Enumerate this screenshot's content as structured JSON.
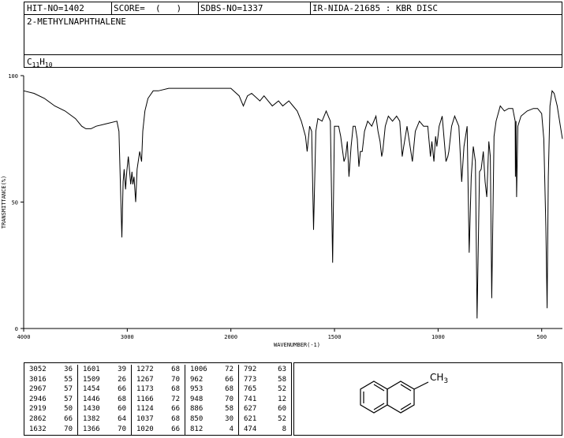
{
  "header": {
    "hit_no": "HIT-NO=1402",
    "score": "SCORE=  (   )",
    "sdbs_no": "SDBS-NO=1337",
    "ir_nida": "IR-NIDA-21685 : KBR DISC",
    "compound_name": "2-METHYLNAPHTHALENE",
    "formula_c": "C",
    "formula_c_count": "11",
    "formula_h": "H",
    "formula_h_count": "10"
  },
  "chart_data": {
    "type": "line",
    "title": "",
    "xlabel": "WAVENUMBER(-1)",
    "ylabel": "TRANSMITTANCE(%)",
    "xlim": [
      4000,
      400
    ],
    "ylim": [
      0,
      100
    ],
    "x_reversed": true,
    "x_ticks": [
      4000,
      3000,
      2000,
      1500,
      1000,
      500
    ],
    "y_ticks": [
      0,
      50,
      100
    ],
    "x_tick_labels": [
      "4000",
      "3000",
      "2000",
      "1500",
      "1000",
      "500"
    ],
    "y_tick_labels": [
      "0",
      "50",
      "100"
    ],
    "grid": false,
    "series": [
      {
        "points": [
          [
            4000,
            94
          ],
          [
            3900,
            93
          ],
          [
            3800,
            91
          ],
          [
            3700,
            88
          ],
          [
            3600,
            86
          ],
          [
            3500,
            83
          ],
          [
            3440,
            80
          ],
          [
            3400,
            79
          ],
          [
            3350,
            79
          ],
          [
            3300,
            80
          ],
          [
            3200,
            81
          ],
          [
            3100,
            82
          ],
          [
            3080,
            78
          ],
          [
            3052,
            36
          ],
          [
            3040,
            58
          ],
          [
            3030,
            63
          ],
          [
            3016,
            55
          ],
          [
            3005,
            62
          ],
          [
            2990,
            68
          ],
          [
            2967,
            57
          ],
          [
            2955,
            62
          ],
          [
            2946,
            57
          ],
          [
            2935,
            60
          ],
          [
            2919,
            50
          ],
          [
            2905,
            63
          ],
          [
            2880,
            70
          ],
          [
            2862,
            66
          ],
          [
            2850,
            78
          ],
          [
            2830,
            86
          ],
          [
            2800,
            91
          ],
          [
            2750,
            94
          ],
          [
            2700,
            94
          ],
          [
            2600,
            95
          ],
          [
            2500,
            95
          ],
          [
            2400,
            95
          ],
          [
            2300,
            95
          ],
          [
            2200,
            95
          ],
          [
            2100,
            95
          ],
          [
            2000,
            95
          ],
          [
            1960,
            92
          ],
          [
            1940,
            88
          ],
          [
            1920,
            92
          ],
          [
            1900,
            93
          ],
          [
            1860,
            90
          ],
          [
            1840,
            92
          ],
          [
            1800,
            88
          ],
          [
            1770,
            90
          ],
          [
            1750,
            88
          ],
          [
            1720,
            90
          ],
          [
            1700,
            88
          ],
          [
            1680,
            86
          ],
          [
            1660,
            82
          ],
          [
            1640,
            76
          ],
          [
            1632,
            70
          ],
          [
            1620,
            80
          ],
          [
            1610,
            78
          ],
          [
            1601,
            39
          ],
          [
            1590,
            78
          ],
          [
            1580,
            83
          ],
          [
            1560,
            82
          ],
          [
            1540,
            86
          ],
          [
            1520,
            82
          ],
          [
            1509,
            26
          ],
          [
            1500,
            80
          ],
          [
            1480,
            80
          ],
          [
            1470,
            76
          ],
          [
            1454,
            66
          ],
          [
            1446,
            68
          ],
          [
            1438,
            74
          ],
          [
            1430,
            60
          ],
          [
            1420,
            72
          ],
          [
            1410,
            80
          ],
          [
            1400,
            80
          ],
          [
            1390,
            75
          ],
          [
            1382,
            64
          ],
          [
            1375,
            70
          ],
          [
            1366,
            70
          ],
          [
            1355,
            78
          ],
          [
            1340,
            82
          ],
          [
            1320,
            80
          ],
          [
            1300,
            84
          ],
          [
            1290,
            78
          ],
          [
            1280,
            74
          ],
          [
            1272,
            68
          ],
          [
            1267,
            70
          ],
          [
            1255,
            80
          ],
          [
            1240,
            84
          ],
          [
            1220,
            82
          ],
          [
            1200,
            84
          ],
          [
            1185,
            82
          ],
          [
            1173,
            68
          ],
          [
            1166,
            72
          ],
          [
            1150,
            80
          ],
          [
            1124,
            66
          ],
          [
            1110,
            78
          ],
          [
            1090,
            82
          ],
          [
            1070,
            80
          ],
          [
            1050,
            80
          ],
          [
            1037,
            68
          ],
          [
            1030,
            74
          ],
          [
            1020,
            66
          ],
          [
            1012,
            76
          ],
          [
            1006,
            72
          ],
          [
            995,
            80
          ],
          [
            980,
            84
          ],
          [
            962,
            66
          ],
          [
            953,
            68
          ],
          [
            948,
            70
          ],
          [
            935,
            80
          ],
          [
            920,
            84
          ],
          [
            900,
            80
          ],
          [
            886,
            58
          ],
          [
            875,
            72
          ],
          [
            860,
            80
          ],
          [
            850,
            30
          ],
          [
            840,
            60
          ],
          [
            830,
            72
          ],
          [
            820,
            66
          ],
          [
            812,
            4
          ],
          [
            800,
            62
          ],
          [
            792,
            63
          ],
          [
            782,
            70
          ],
          [
            773,
            58
          ],
          [
            765,
            52
          ],
          [
            755,
            74
          ],
          [
            748,
            68
          ],
          [
            741,
            12
          ],
          [
            730,
            76
          ],
          [
            720,
            82
          ],
          [
            700,
            88
          ],
          [
            680,
            86
          ],
          [
            660,
            87
          ],
          [
            640,
            87
          ],
          [
            628,
            82
          ],
          [
            627,
            60
          ],
          [
            624,
            82
          ],
          [
            621,
            52
          ],
          [
            615,
            80
          ],
          [
            600,
            84
          ],
          [
            570,
            86
          ],
          [
            540,
            87
          ],
          [
            520,
            87
          ],
          [
            500,
            85
          ],
          [
            490,
            75
          ],
          [
            480,
            40
          ],
          [
            474,
            8
          ],
          [
            468,
            60
          ],
          [
            460,
            88
          ],
          [
            450,
            94
          ],
          [
            440,
            93
          ],
          [
            425,
            88
          ],
          [
            410,
            80
          ],
          [
            400,
            75
          ]
        ]
      }
    ],
    "peak_table": [
      [
        "3052",
        "36"
      ],
      [
        "3016",
        "55"
      ],
      [
        "2967",
        "57"
      ],
      [
        "2946",
        "57"
      ],
      [
        "2919",
        "50"
      ],
      [
        "2862",
        "66"
      ],
      [
        "1632",
        "70"
      ],
      [
        "1601",
        "39"
      ],
      [
        "1509",
        "26"
      ],
      [
        "1454",
        "66"
      ],
      [
        "1446",
        "68"
      ],
      [
        "1430",
        "60"
      ],
      [
        "1382",
        "64"
      ],
      [
        "1366",
        "70"
      ],
      [
        "1272",
        "68"
      ],
      [
        "1267",
        "70"
      ],
      [
        "1173",
        "68"
      ],
      [
        "1166",
        "72"
      ],
      [
        "1124",
        "66"
      ],
      [
        "1037",
        "68"
      ],
      [
        "1020",
        "66"
      ],
      [
        "1006",
        "72"
      ],
      [
        "962",
        "66"
      ],
      [
        "953",
        "68"
      ],
      [
        "948",
        "70"
      ],
      [
        "886",
        "58"
      ],
      [
        "850",
        "30"
      ],
      [
        "812",
        "4"
      ],
      [
        "792",
        "63"
      ],
      [
        "773",
        "58"
      ],
      [
        "765",
        "52"
      ],
      [
        "741",
        "12"
      ],
      [
        "627",
        "60"
      ],
      [
        "621",
        "52"
      ],
      [
        "474",
        "8"
      ]
    ]
  },
  "structure": {
    "substituent_label": "CH",
    "substituent_sub": "3"
  }
}
